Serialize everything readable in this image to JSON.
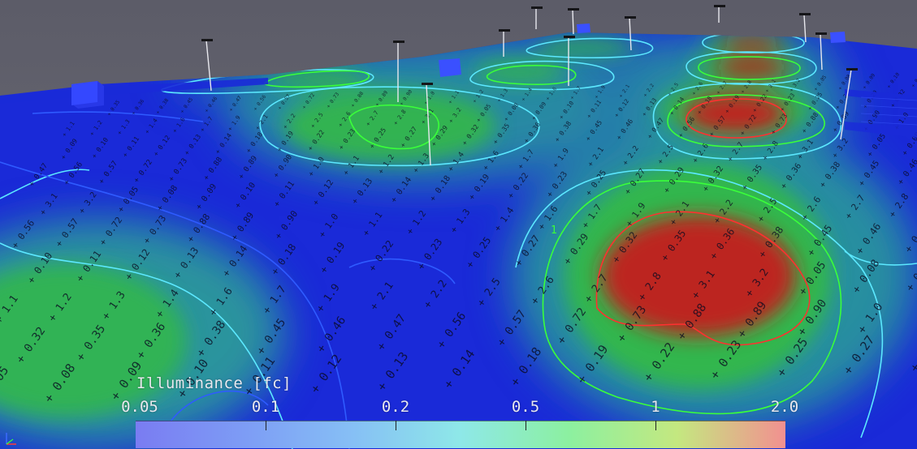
{
  "legend": {
    "title": "Illuminance [fc]",
    "ticks": [
      {
        "label": "0.05",
        "pos": 0.0
      },
      {
        "label": "0.1",
        "pos": 0.2
      },
      {
        "label": "0.2",
        "pos": 0.4
      },
      {
        "label": "0.5",
        "pos": 0.6
      },
      {
        "label": "1",
        "pos": 0.8
      },
      {
        "label": "2.0",
        "pos": 1.0
      }
    ],
    "gradient": [
      "#7a7cf2",
      "#7d9cf5",
      "#86bff5",
      "#8ee8e8",
      "#8cf0a0",
      "#c4e880",
      "#f29090"
    ]
  },
  "scene": {
    "colors": {
      "sky_top": "#5c5c68",
      "sky_bottom": "#6e6e78",
      "low": "#1a2ad8",
      "mid": "#2a9a9a",
      "green": "#33b848",
      "red": "#c41a1a",
      "contour_cyan": "#5ce8ff",
      "contour_green": "#3aff3a",
      "contour_red": "#ff3030"
    },
    "value_labels": [
      "0.05",
      "0.08",
      "0.09",
      "0.10",
      "0.11",
      "0.12",
      "0.13",
      "0.14",
      "0.18",
      "0.19",
      "0.22",
      "0.23",
      "0.25",
      "0.27",
      "0.29",
      "0.32",
      "0.35",
      "0.36",
      "0.38",
      "0.45",
      "0.46",
      "0.47",
      "0.56",
      "0.57",
      "0.72",
      "0.73",
      "0.88",
      "0.89",
      "0.90",
      "1.0",
      "1.1",
      "1.2",
      "1.3",
      "1.4",
      "1.6",
      "1.7",
      "1.9",
      "2.1",
      "2.2",
      "2.5",
      "2.6",
      "2.7",
      "2.8",
      "3.1",
      "3.2"
    ],
    "contour_label": "1"
  }
}
